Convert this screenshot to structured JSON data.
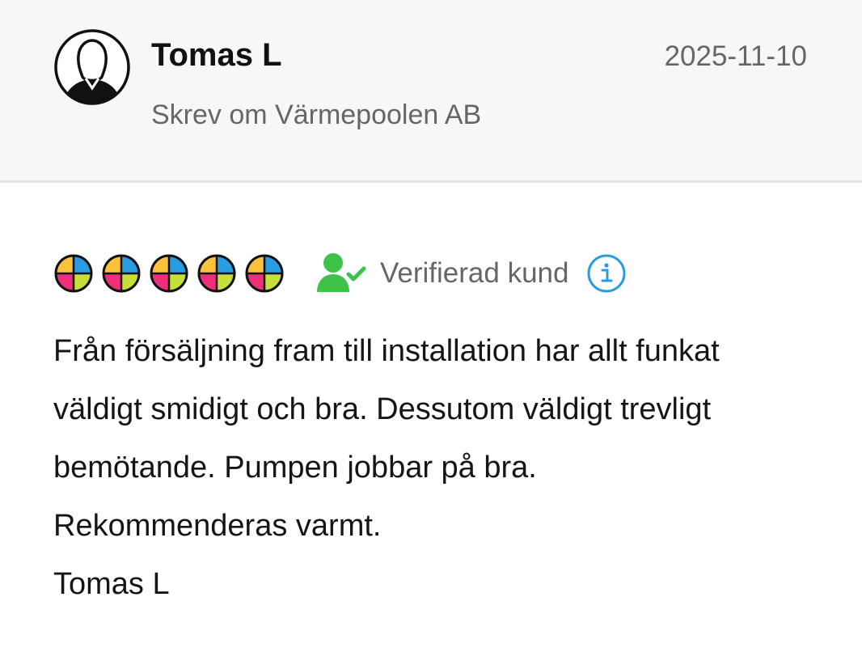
{
  "reviewer": {
    "name": "Tomas L",
    "date": "2025-11-10",
    "wrote_about": "Skrev om Värmepoolen AB",
    "avatar_icon": "user-silhouette-icon"
  },
  "rating": {
    "value": 5,
    "max": 5,
    "icon": "quad-color-circle-icon",
    "colors": {
      "top_left": "#f9c23c",
      "top_right": "#2a9ce0",
      "bottom_left": "#ee2f7a",
      "bottom_right": "#c6df3a",
      "outline": "#111111"
    }
  },
  "verification": {
    "label": "Verifierad kund",
    "icon": "verified-user-icon",
    "icon_color": "#3ec24a",
    "info_icon": "info-icon",
    "info_color": "#2a9ce0"
  },
  "review": {
    "lines": [
      "Från försäljning fram till installation har allt funkat",
      "väldigt smidigt och bra. Dessutom väldigt trevligt",
      "bemötande. Pumpen jobbar på bra.",
      "Rekommenderas varmt.",
      "Tomas L"
    ]
  }
}
